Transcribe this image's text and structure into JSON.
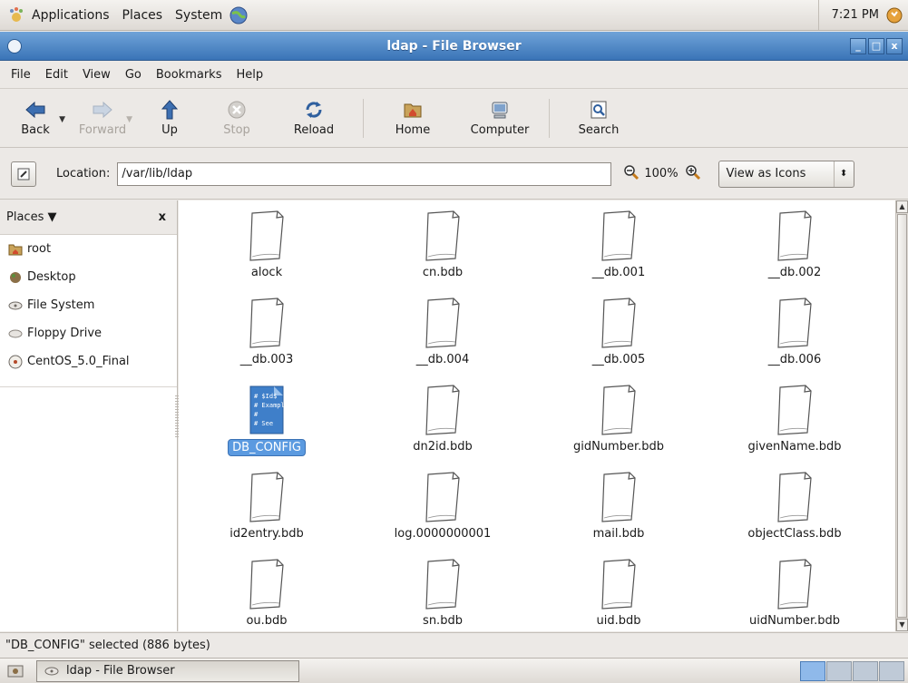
{
  "panel": {
    "menus": [
      "Applications",
      "Places",
      "System"
    ],
    "clock": "7:21 PM"
  },
  "window": {
    "title": "ldap - File Browser",
    "controls": [
      "_",
      "□",
      "x"
    ]
  },
  "menubar": {
    "items": [
      "File",
      "Edit",
      "View",
      "Go",
      "Bookmarks",
      "Help"
    ]
  },
  "toolbar": {
    "back": "Back",
    "forward": "Forward",
    "up": "Up",
    "stop": "Stop",
    "reload": "Reload",
    "home": "Home",
    "computer": "Computer",
    "search": "Search"
  },
  "location": {
    "label": "Location:",
    "value": "/var/lib/ldap",
    "zoom": "100%",
    "view_mode": "View as Icons"
  },
  "sidebar": {
    "title": "Places",
    "close": "x",
    "items": [
      {
        "label": "root",
        "icon": "home-folder-icon"
      },
      {
        "label": "Desktop",
        "icon": "desktop-icon"
      },
      {
        "label": "File System",
        "icon": "harddisk-icon"
      },
      {
        "label": "Floppy Drive",
        "icon": "floppy-icon"
      },
      {
        "label": "CentOS_5.0_Final",
        "icon": "cdrom-icon"
      }
    ]
  },
  "files": [
    {
      "name": "alock"
    },
    {
      "name": "cn.bdb"
    },
    {
      "name": "__db.001"
    },
    {
      "name": "__db.002"
    },
    {
      "name": "__db.003"
    },
    {
      "name": "__db.004"
    },
    {
      "name": "__db.005"
    },
    {
      "name": "__db.006"
    },
    {
      "name": "DB_CONFIG",
      "selected": true,
      "preview": [
        "# $Id$",
        "# Example",
        "#",
        "# See"
      ]
    },
    {
      "name": "dn2id.bdb"
    },
    {
      "name": "gidNumber.bdb"
    },
    {
      "name": "givenName.bdb"
    },
    {
      "name": "id2entry.bdb"
    },
    {
      "name": "log.0000000001"
    },
    {
      "name": "mail.bdb"
    },
    {
      "name": "objectClass.bdb"
    },
    {
      "name": "ou.bdb"
    },
    {
      "name": "sn.bdb"
    },
    {
      "name": "uid.bdb"
    },
    {
      "name": "uidNumber.bdb"
    }
  ],
  "status": {
    "text": "\"DB_CONFIG\" selected (886 bytes)"
  },
  "taskbar": {
    "window_button": "ldap - File Browser"
  },
  "colors": {
    "selection": "#5b9ae0",
    "titlebar": "#3a74b7"
  }
}
